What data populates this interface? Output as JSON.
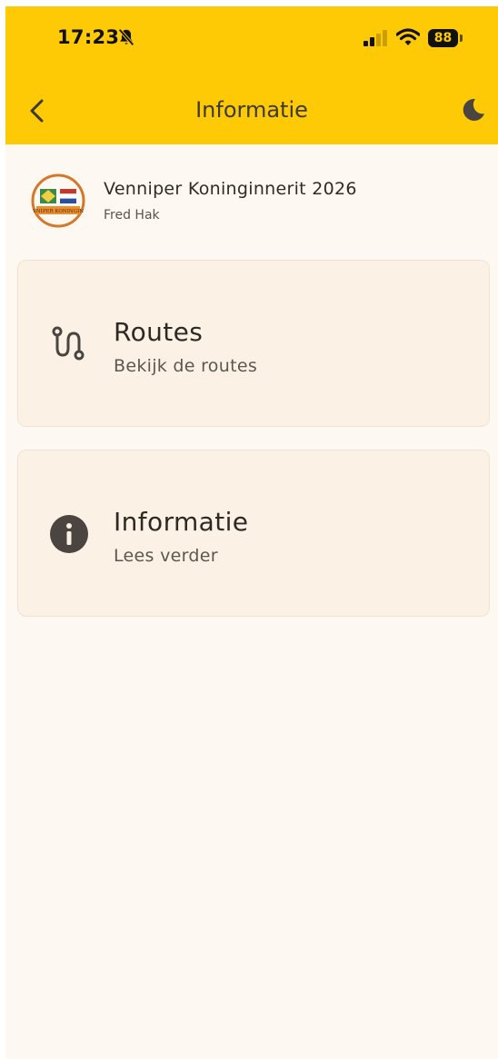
{
  "status_bar": {
    "time": "17:23",
    "battery": "88",
    "icons": [
      "bell-slash-icon",
      "cellular-signal-icon",
      "wifi-icon",
      "battery-icon"
    ]
  },
  "nav": {
    "title": "Informatie",
    "back_icon": "chevron-left-icon",
    "theme_icon": "moon-icon"
  },
  "event": {
    "title": "Venniper Koninginnerit 2026",
    "author": "Fred Hak",
    "logo_text": "VNIPER KONINGIN"
  },
  "cards": [
    {
      "title": "Routes",
      "subtitle": "Bekijk de routes",
      "icon": "route-icon"
    },
    {
      "title": "Informatie",
      "subtitle": "Lees verder",
      "icon": "info-icon"
    }
  ],
  "colors": {
    "accent": "#fec905",
    "background": "#fdf8f2",
    "card": "#fbf1e5",
    "icon": "#4a4540"
  }
}
